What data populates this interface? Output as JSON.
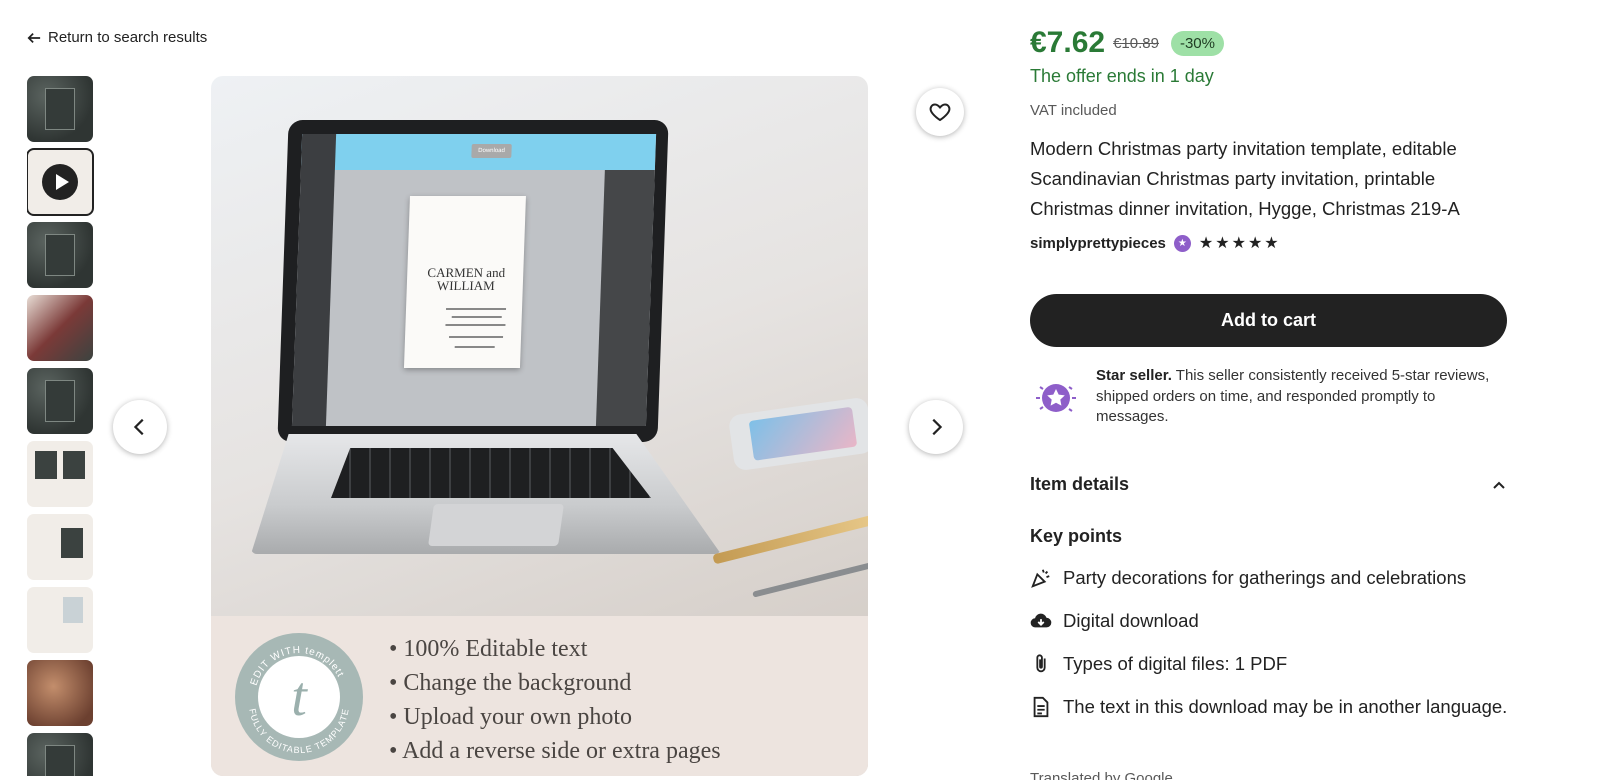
{
  "nav": {
    "back_label": "Return to search results"
  },
  "gallery": {
    "thumbnail_count": 10,
    "selected_index": 1,
    "image_caption": {
      "badge_top": "EDIT WITH templett",
      "badge_bottom": "FULLY EDITABLE TEMPLATE",
      "badge_letter": "t",
      "bullets": [
        "100% Editable text",
        "Change the background",
        "Upload your own photo",
        "Add a reverse side or extra pages"
      ]
    },
    "screen": {
      "download_label": "Download",
      "doc_names": "CARMEN and WILLIAM"
    }
  },
  "product": {
    "price": "€7.62",
    "original_price": "€10.89",
    "discount": "-30%",
    "offer_text": "The offer ends in 1 day",
    "vat_text": "VAT included",
    "title": "Modern Christmas party invitation template, editable Scandinavian Christmas party invitation, printable Christmas dinner invitation, Hygge, Christmas 219-A",
    "seller": "simplyprettypieces",
    "rating_stars": "★★★★★",
    "add_to_cart_label": "Add to cart",
    "star_seller_title": "Star seller.",
    "star_seller_text": "This seller consistently received 5-star reviews, shipped orders on time, and responded promptly to messages.",
    "item_details_label": "Item details",
    "key_points_label": "Key points",
    "key_points": [
      {
        "icon": "party-popper-icon",
        "text": "Party decorations for gatherings and celebrations"
      },
      {
        "icon": "cloud-download-icon",
        "text": "Digital download"
      },
      {
        "icon": "paperclip-icon",
        "text": "Types of digital files: 1 PDF"
      },
      {
        "icon": "document-icon",
        "text": "The text in this download may be in another language."
      }
    ],
    "cut_off_text": "Translated by Google"
  },
  "colors": {
    "price_green": "#2a7a36",
    "discount_bg": "#9ee0a6",
    "star_seller_purple": "#8e5ec9",
    "button_dark": "#222222"
  }
}
